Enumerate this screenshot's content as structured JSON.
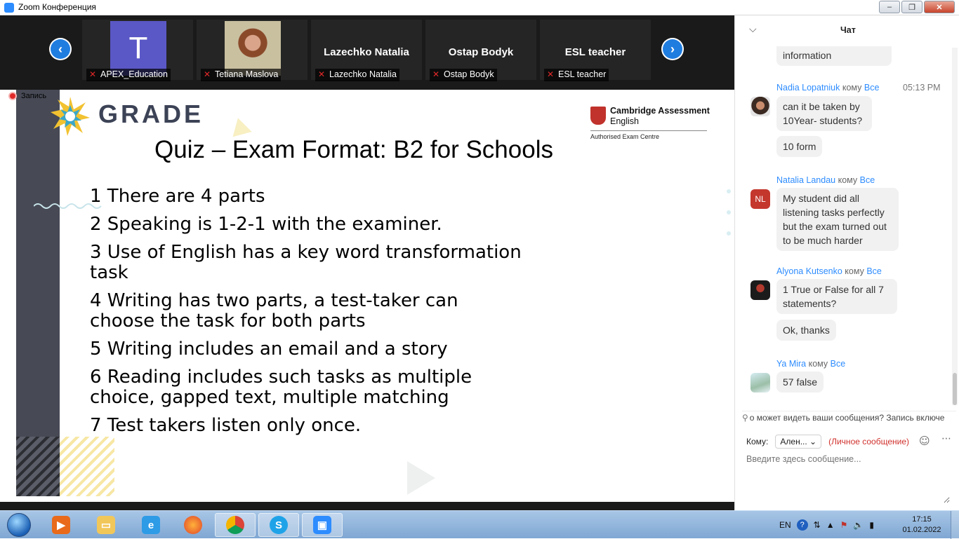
{
  "window": {
    "title": "Zoom Конференция",
    "minimize": "–",
    "restore": "❐",
    "close": "✕"
  },
  "video_strip": {
    "prev": "‹",
    "next": "›",
    "participants": [
      {
        "label": "APEX_Education",
        "avatar_letter": "T"
      },
      {
        "label": "Tetiana Maslova"
      },
      {
        "label": "Lazechko Natalia",
        "display_name": "Lazechko Natalia"
      },
      {
        "label": "Ostap Bodyk",
        "display_name": "Ostap Bodyk"
      },
      {
        "label": "ESL teacher",
        "display_name": "ESL teacher"
      }
    ]
  },
  "recording": {
    "label": "Запись"
  },
  "slide": {
    "logo_text": "GRADE",
    "cambridge_line1": "Cambridge Assessment",
    "cambridge_line2": "English",
    "cambridge_line3": "Authorised Exam Centre",
    "title": "Quiz – Exam Format: B2 for Schools",
    "items": [
      "1 There are 4 parts",
      "2 Speaking is 1-2-1 with the examiner.",
      "3 Use of English has a key word transformation task",
      "4 Writing has two parts, a test-taker can choose the task for both parts",
      "5 Writing includes an email and a story",
      "6 Reading includes such tasks as multiple choice, gapped text, multiple matching",
      "7 Test takers listen only once."
    ]
  },
  "chat": {
    "title": "Чат",
    "partial_message": "information",
    "messages": [
      {
        "sender": "Nadia Lopatniuk",
        "to_word": "кому",
        "to": "Все",
        "time": "05:13 PM",
        "texts": [
          "can it be taken by 10Year- students?",
          "10 form"
        ]
      },
      {
        "sender": "Natalia Landau",
        "to_word": "кому",
        "to": "Все",
        "avatar_initials": "NL",
        "texts": [
          "My student did all listening tasks perfectly but the exam turned out to be much harder"
        ]
      },
      {
        "sender": "Alyona Kutsenko",
        "to_word": "кому",
        "to": "Все",
        "texts": [
          "1 True or False for all 7 statements?",
          "Ok, thanks"
        ]
      },
      {
        "sender": "Ya Mira",
        "to_word": "кому",
        "to": "Все",
        "texts": [
          "57 false"
        ]
      }
    ],
    "notice": "о может видеть ваши сообщения? Запись включе",
    "to_label": "Кому:",
    "recipient": "Ален...",
    "private_label": "(Личное сообщение)",
    "input_placeholder": "Введите здесь сообщение..."
  },
  "taskbar": {
    "language": "EN",
    "time": "17:15",
    "date": "01.02.2022"
  }
}
